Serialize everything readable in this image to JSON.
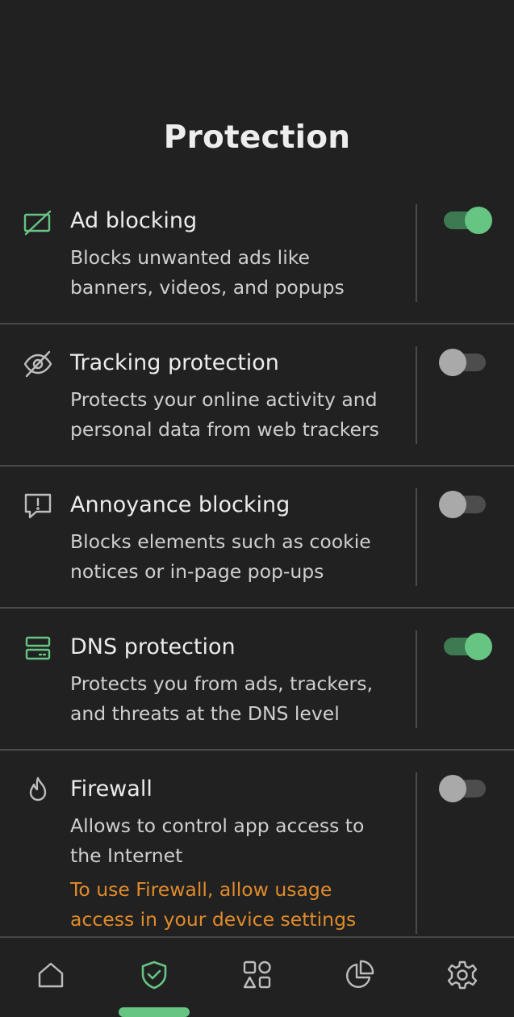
{
  "page": {
    "title": "Protection"
  },
  "colors": {
    "background": "#212121",
    "accent_green": "#67c584",
    "warning_orange": "#e08b2a",
    "icon_gray": "#bdbdbd"
  },
  "items": [
    {
      "icon": "ad-blocking-icon",
      "title": "Ad blocking",
      "desc": [
        "Blocks unwanted ads like",
        "banners, videos, and popups"
      ],
      "enabled": true
    },
    {
      "icon": "eye-off-icon",
      "title": "Tracking protection",
      "desc": [
        "Protects your online activity and",
        "personal data from web trackers"
      ],
      "enabled": false
    },
    {
      "icon": "annoyance-icon",
      "title": "Annoyance blocking",
      "desc": [
        "Blocks elements such as cookie",
        "notices or in-page pop-ups"
      ],
      "enabled": false
    },
    {
      "icon": "dns-server-icon",
      "title": "DNS protection",
      "desc": [
        "Protects you from ads, trackers,",
        "and threats at the DNS level"
      ],
      "enabled": true
    },
    {
      "icon": "flame-icon",
      "title": "Firewall",
      "desc": [
        "Allows to control app access to",
        "the Internet"
      ],
      "warning": [
        "To use Firewall, allow usage",
        "access in your device settings"
      ],
      "enabled": false
    }
  ],
  "nav": [
    {
      "icon": "home-icon",
      "active": false
    },
    {
      "icon": "shield-check-icon",
      "active": true
    },
    {
      "icon": "apps-icon",
      "active": false
    },
    {
      "icon": "stats-pie-icon",
      "active": false
    },
    {
      "icon": "gear-icon",
      "active": false
    }
  ]
}
